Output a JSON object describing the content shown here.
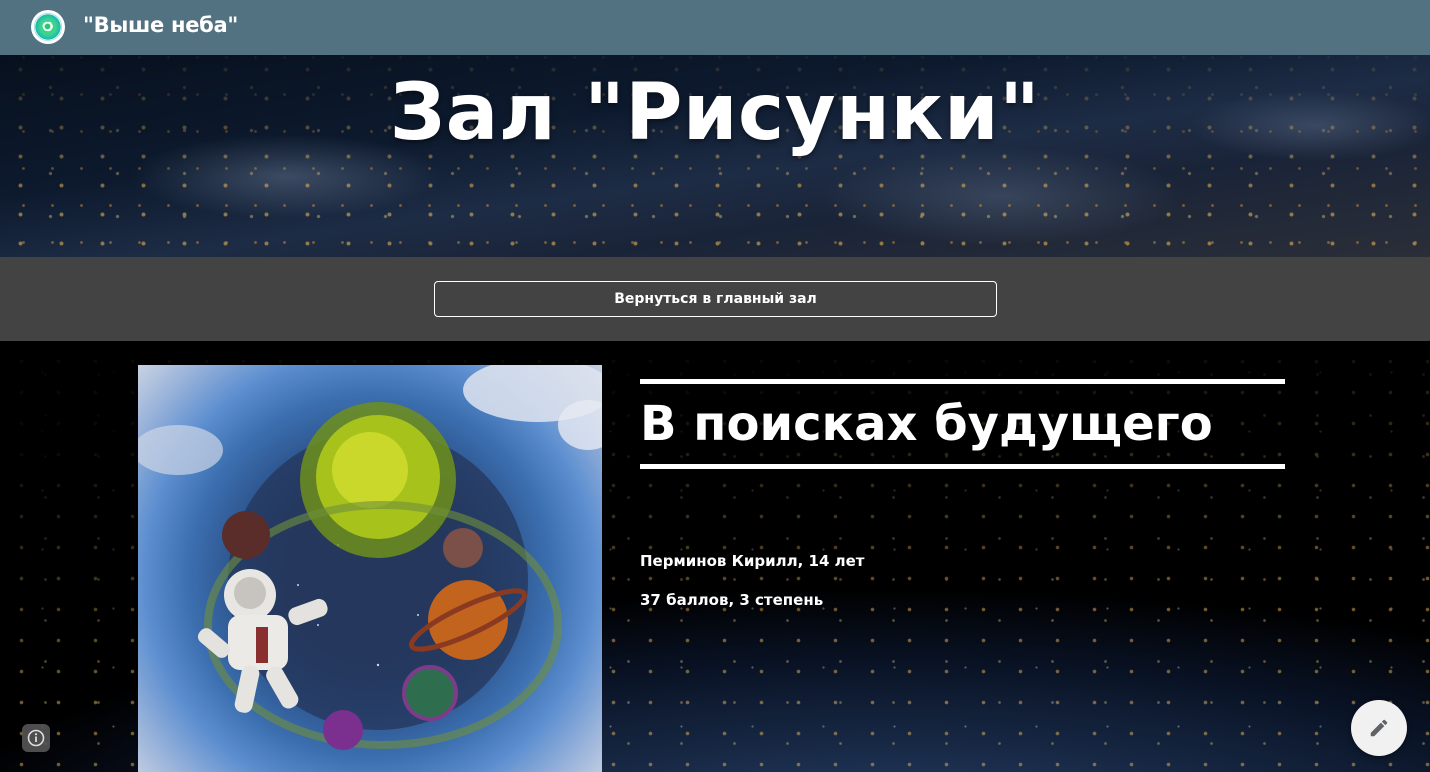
{
  "header": {
    "site_title": "\"Выше неба\"",
    "logo_icon": "globe-logo-icon",
    "bar_color": "#527282"
  },
  "hero": {
    "title": "Зал \"Рисунки\""
  },
  "navigation": {
    "back_label": "Вернуться в главный зал"
  },
  "artwork": {
    "title": "В поисках будущего",
    "author": "Перминов Кирилл, 14 лет",
    "score": "37 баллов, 3 степень",
    "image_icon": "space-painting-image"
  },
  "controls": {
    "info_icon": "info-icon",
    "edit_icon": "pencil-icon"
  }
}
